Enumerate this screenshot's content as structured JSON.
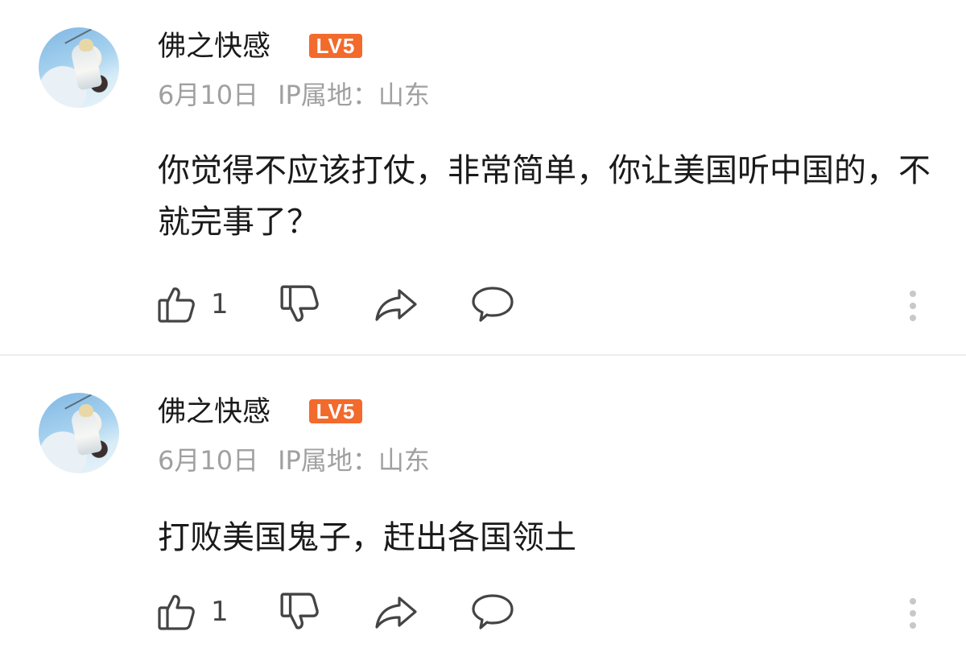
{
  "comments": [
    {
      "username": "佛之快感",
      "level_badge": "LV5",
      "date": "6月10日",
      "ip_location": "IP属地：山东",
      "text": "你觉得不应该打仗，非常简单，你让美国听中国的，不就完事了？",
      "like_count": "1"
    },
    {
      "username": "佛之快感",
      "level_badge": "LV5",
      "date": "6月10日",
      "ip_location": "IP属地：山东",
      "text": "打败美国鬼子，赶出各国领土",
      "like_count": "1"
    }
  ],
  "icons": {
    "like": "thumbs-up-icon",
    "dislike": "thumbs-down-icon",
    "share": "share-arrow-icon",
    "reply": "comment-bubble-icon",
    "more": "more-vertical-icon"
  },
  "colors": {
    "level_badge": "#f26a2c",
    "meta_text": "#a0a0a0",
    "icon_stroke": "#444444",
    "divider": "#eeeeee"
  }
}
